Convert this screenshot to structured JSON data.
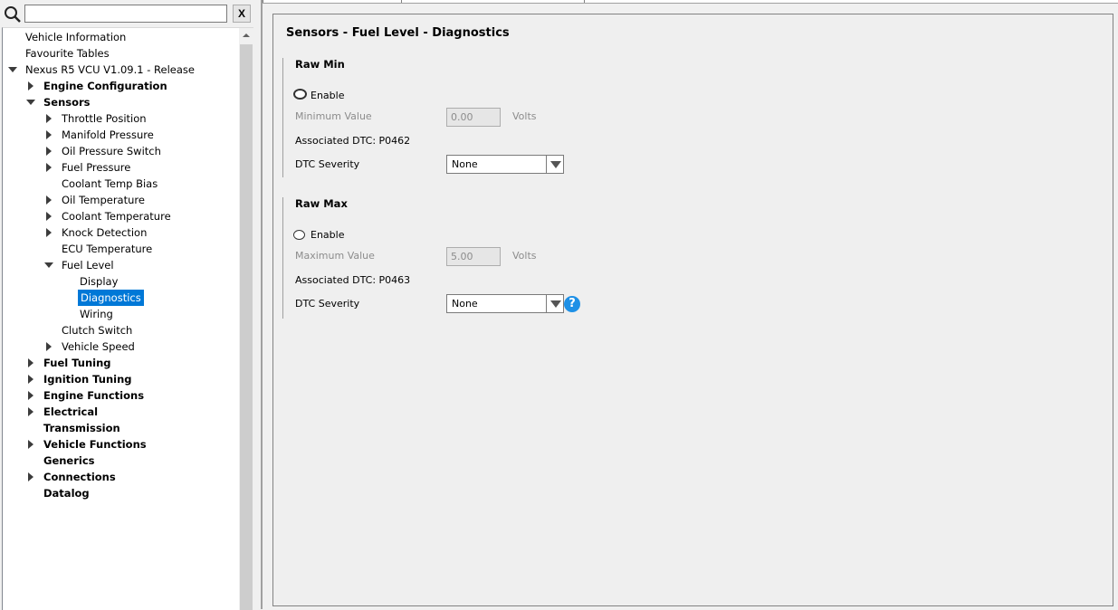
{
  "search": {
    "placeholder": "",
    "value": "",
    "clear_label": "X"
  },
  "tree": {
    "items": [
      {
        "label": "Vehicle Information",
        "level": 0,
        "bold": false,
        "expander": "none"
      },
      {
        "label": "Favourite Tables",
        "level": 0,
        "bold": false,
        "expander": "none"
      },
      {
        "label": "Nexus R5 VCU V1.09.1 - Release",
        "level": 0,
        "bold": false,
        "expander": "down"
      },
      {
        "label": "Engine Configuration",
        "level": 1,
        "bold": true,
        "expander": "right"
      },
      {
        "label": "Sensors",
        "level": 1,
        "bold": true,
        "expander": "down"
      },
      {
        "label": "Throttle Position",
        "level": 2,
        "bold": false,
        "expander": "right"
      },
      {
        "label": "Manifold Pressure",
        "level": 2,
        "bold": false,
        "expander": "right"
      },
      {
        "label": "Oil Pressure Switch",
        "level": 2,
        "bold": false,
        "expander": "right"
      },
      {
        "label": "Fuel Pressure",
        "level": 2,
        "bold": false,
        "expander": "right"
      },
      {
        "label": "Coolant Temp Bias",
        "level": 2,
        "bold": false,
        "expander": "none"
      },
      {
        "label": "Oil Temperature",
        "level": 2,
        "bold": false,
        "expander": "right"
      },
      {
        "label": "Coolant Temperature",
        "level": 2,
        "bold": false,
        "expander": "right"
      },
      {
        "label": "Knock Detection",
        "level": 2,
        "bold": false,
        "expander": "right"
      },
      {
        "label": "ECU Temperature",
        "level": 2,
        "bold": false,
        "expander": "none"
      },
      {
        "label": "Fuel Level",
        "level": 2,
        "bold": false,
        "expander": "down"
      },
      {
        "label": "Display",
        "level": 3,
        "bold": false,
        "expander": "none"
      },
      {
        "label": "Diagnostics",
        "level": 3,
        "bold": false,
        "expander": "none",
        "selected": true
      },
      {
        "label": "Wiring",
        "level": 3,
        "bold": false,
        "expander": "none"
      },
      {
        "label": "Clutch Switch",
        "level": 2,
        "bold": false,
        "expander": "none"
      },
      {
        "label": "Vehicle Speed",
        "level": 2,
        "bold": false,
        "expander": "right"
      },
      {
        "label": "Fuel Tuning",
        "level": 1,
        "bold": true,
        "expander": "right"
      },
      {
        "label": "Ignition Tuning",
        "level": 1,
        "bold": true,
        "expander": "right"
      },
      {
        "label": "Engine Functions",
        "level": 1,
        "bold": true,
        "expander": "right"
      },
      {
        "label": "Electrical",
        "level": 1,
        "bold": true,
        "expander": "right"
      },
      {
        "label": "Transmission",
        "level": 1,
        "bold": true,
        "expander": "none"
      },
      {
        "label": "Vehicle Functions",
        "level": 1,
        "bold": true,
        "expander": "right"
      },
      {
        "label": "Generics",
        "level": 1,
        "bold": true,
        "expander": "none"
      },
      {
        "label": "Connections",
        "level": 1,
        "bold": true,
        "expander": "right"
      },
      {
        "label": "Datalog",
        "level": 1,
        "bold": true,
        "expander": "none"
      }
    ]
  },
  "content": {
    "title": "Sensors - Fuel Level - Diagnostics",
    "raw_min": {
      "title": "Raw Min",
      "enable_label": "Enable",
      "enabled": false,
      "value_label": "Minimum Value",
      "value": "0.00",
      "unit": "Volts",
      "dtc_text": "Associated DTC: P0462",
      "severity_label": "DTC Severity",
      "severity_value": "None"
    },
    "raw_max": {
      "title": "Raw Max",
      "enable_label": "Enable",
      "enabled": false,
      "value_label": "Maximum Value",
      "value": "5.00",
      "unit": "Volts",
      "dtc_text": "Associated DTC: P0463",
      "severity_label": "DTC Severity",
      "severity_value": "None"
    },
    "help_label": "?"
  },
  "colors": {
    "selection": "#0078d7",
    "help_icon": "#1e90e6"
  }
}
